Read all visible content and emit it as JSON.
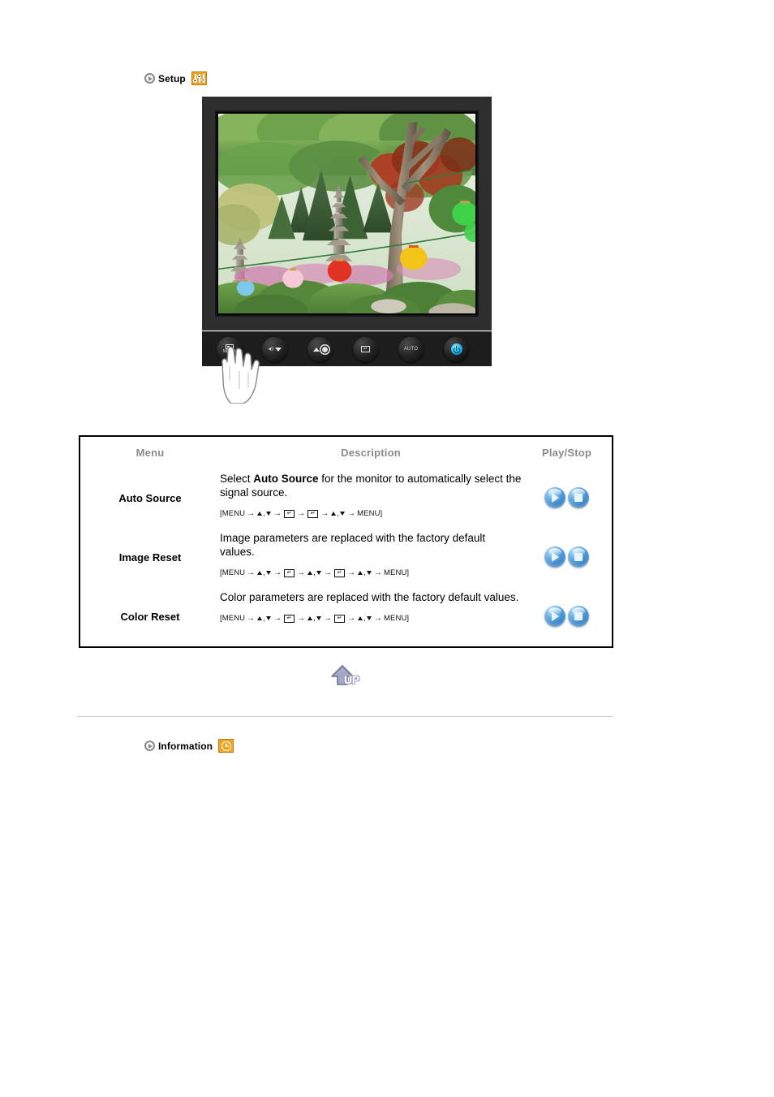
{
  "sections": {
    "setup": {
      "title": "Setup",
      "bullet_icon": "arrow-circle-icon",
      "badge_icon": "setup-sliders-icon",
      "badge_color": "#f0a423"
    },
    "information": {
      "title": "Information",
      "bullet_icon": "arrow-circle-icon",
      "badge_icon": "clock-icon",
      "badge_color": "#f0a423"
    }
  },
  "monitor": {
    "screen_image_alt": "Garden scene with stone pagoda, evergreen trees and colored paper lanterns",
    "buttons": [
      {
        "name": "menu-button",
        "label": "MENU",
        "glyph": "menu-icon"
      },
      {
        "name": "down-button",
        "label": "",
        "glyph": "volume-down-icon"
      },
      {
        "name": "brightness-button",
        "label": "",
        "glyph": "brightness-up-icon"
      },
      {
        "name": "enter-button",
        "label": "",
        "glyph": "enter-icon"
      },
      {
        "name": "auto-button",
        "label": "AUTO",
        "glyph": "auto-icon"
      },
      {
        "name": "power-button",
        "label": "",
        "glyph": "power-icon"
      }
    ],
    "hand_pointer": "hand-pressing-menu"
  },
  "table": {
    "headers": {
      "menu": "Menu",
      "description": "Description",
      "playstop": "Play/Stop"
    },
    "rows": [
      {
        "menu": "Auto Source",
        "desc_pre": "Select ",
        "desc_bold": "Auto Source",
        "desc_post": " for the monitor to automatically select the signal source.",
        "sequence": "[MENU → ▲,▼ → ↵ → ↵ → ▲,▼ → MENU]",
        "sequence_tokens": [
          "[MENU",
          "arrow",
          "updown",
          "arrow",
          "enterkey",
          "arrow",
          "enterkey",
          "arrow",
          "updown",
          "arrow",
          "MENU]"
        ],
        "play_label": "Play",
        "stop_label": "Stop"
      },
      {
        "menu": "Image Reset",
        "desc_pre": "",
        "desc_bold": "",
        "desc_post": "Image parameters are replaced with the factory default values.",
        "sequence": "[MENU → ▲,▼ → ↵ → ▲,▼ → ↵ → ▲,▼ → MENU]",
        "sequence_tokens": [
          "[MENU",
          "arrow",
          "updown",
          "arrow",
          "enterkey",
          "arrow",
          "updown",
          "arrow",
          "enterkey",
          "arrow",
          "updown",
          "arrow",
          "MENU]"
        ],
        "play_label": "Play",
        "stop_label": "Stop"
      },
      {
        "menu": "Color Reset",
        "desc_pre": "",
        "desc_bold": "",
        "desc_post": "Color parameters are replaced with the factory default values.",
        "sequence": "[MENU → ▲,▼ → ↵ → ▲,▼ → ↵ → ▲,▼ → MENU]",
        "sequence_tokens": [
          "[MENU",
          "arrow",
          "updown",
          "arrow",
          "enterkey",
          "arrow",
          "updown",
          "arrow",
          "enterkey",
          "arrow",
          "updown",
          "arrow",
          "MENU]"
        ],
        "play_label": "Play",
        "stop_label": "Stop"
      }
    ]
  },
  "up_button": {
    "label": "UP",
    "icon": "up-arrow-icon"
  },
  "colors": {
    "header_text": "#8b8b8b",
    "badge_orange": "#f0a423",
    "orb_blue": "#2f7dc4",
    "monitor_bezel": "#2e2e2e",
    "divider": "#c8c8c8"
  }
}
